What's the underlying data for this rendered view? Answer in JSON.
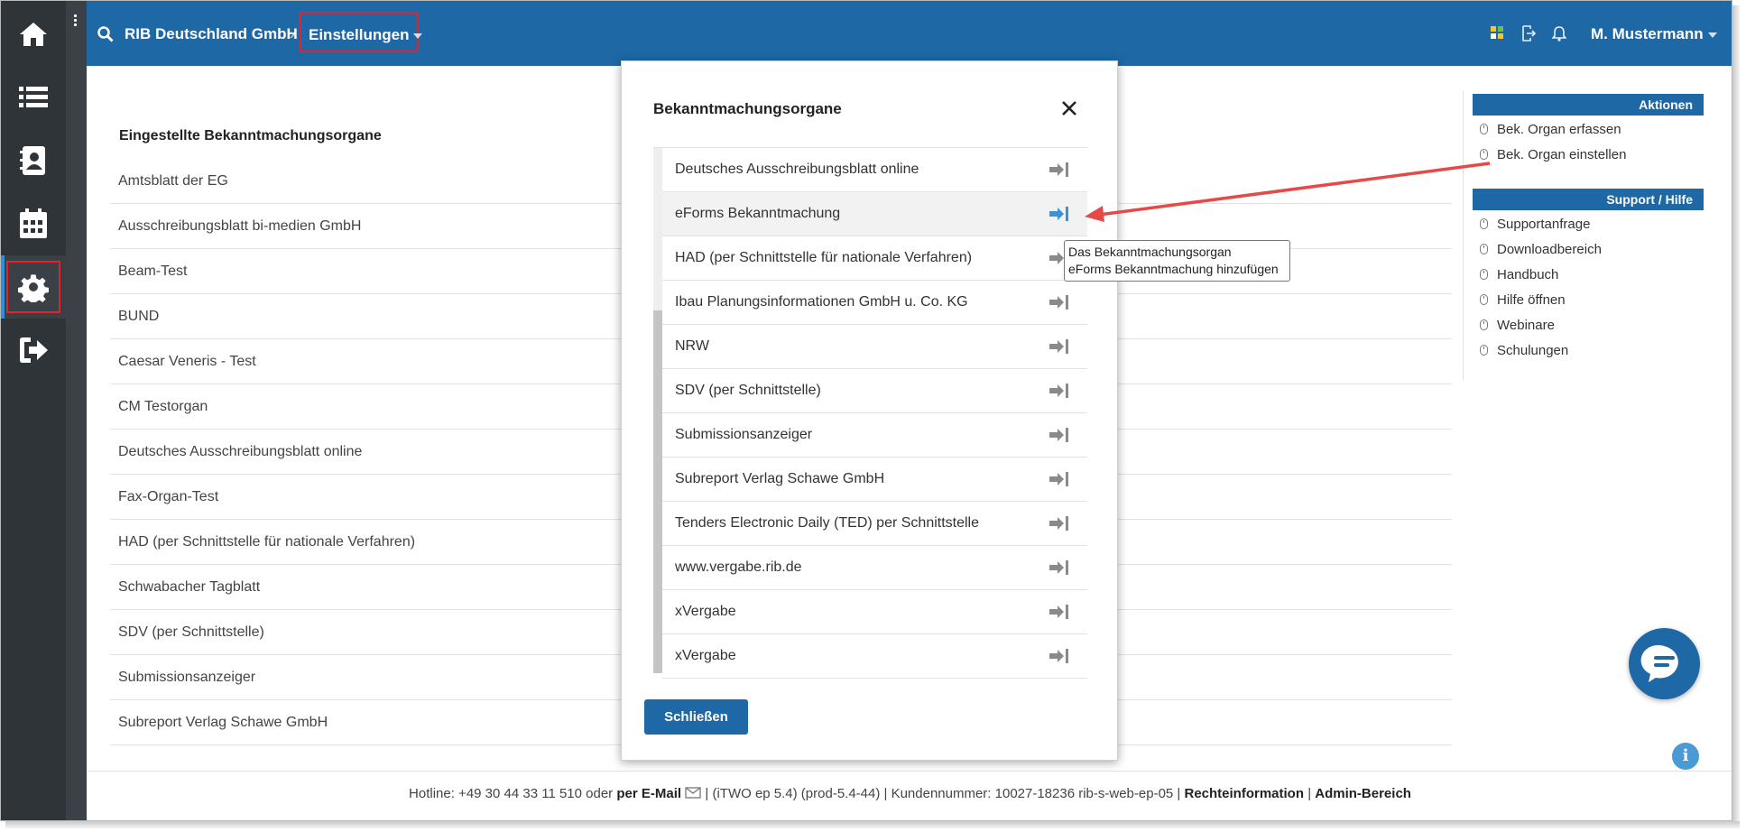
{
  "header": {
    "company": "RIB Deutschland GmbH",
    "breadcrumb": "Einstellungen",
    "user": "M. Mustermann"
  },
  "sidebar": {
    "items": [
      {
        "icon": "home-icon"
      },
      {
        "icon": "list-icon"
      },
      {
        "icon": "address-book-icon"
      },
      {
        "icon": "calendar-icon"
      },
      {
        "icon": "gear-icon",
        "active": true
      },
      {
        "icon": "sign-out-icon"
      }
    ]
  },
  "main": {
    "heading": "Eingestellte Bekanntmachungsorgane",
    "rows": [
      "Amtsblatt der EG",
      "Ausschreibungsblatt bi-medien GmbH",
      "Beam-Test",
      "BUND",
      "Caesar Veneris - Test",
      "CM Testorgan",
      "Deutsches Ausschreibungsblatt online",
      "Fax-Organ-Test",
      "HAD (per Schnittstelle für nationale Verfahren)",
      "Schwabacher Tagblatt",
      "SDV (per Schnittstelle)",
      "Submissionsanzeiger",
      "Subreport Verlag Schawe GmbH"
    ]
  },
  "right_panel": {
    "actions_title": "Aktionen",
    "actions": [
      "Bek. Organ erfassen",
      "Bek. Organ einstellen"
    ],
    "support_title": "Support / Hilfe",
    "support": [
      "Supportanfrage",
      "Downloadbereich",
      "Handbuch",
      "Hilfe öffnen",
      "Webinare",
      "Schulungen"
    ]
  },
  "modal": {
    "title": "Bekanntmachungsorgane",
    "items": [
      "Deutsches Ausschreibungsblatt online",
      "eForms Bekanntmachung",
      "HAD (per Schnittstelle für nationale Verfahren)",
      "Ibau Planungsinformationen GmbH u. Co. KG",
      "NRW",
      "SDV (per Schnittstelle)",
      "Submissionsanzeiger",
      "Subreport Verlag Schawe GmbH",
      "Tenders Electronic Daily (TED) per Schnittstelle",
      "www.vergabe.rib.de",
      "xVergabe",
      "xVergabe"
    ],
    "hover_index": 1,
    "close_button": "Schließen",
    "tooltip_line1": "Das Bekanntmachungsorgan",
    "tooltip_line2": "eForms Bekanntmachung hinzufügen"
  },
  "footer": {
    "hotline": "Hotline: +49 30 44 33 11 510 oder",
    "email": "per E-Mail",
    "version": "|  (iTWO ep 5.4) (prod-5.4-44)  |  Kundennummer: 10027-18236 rib-s-web-ep-05 |",
    "legal": "Rechteinformation",
    "sep": "|",
    "admin": "Admin-Bereich"
  },
  "colors": {
    "brand": "#1e68a6",
    "sidebar": "#2f3438",
    "highlight": "#e0242b",
    "active_icon": "#2f8fd8"
  }
}
